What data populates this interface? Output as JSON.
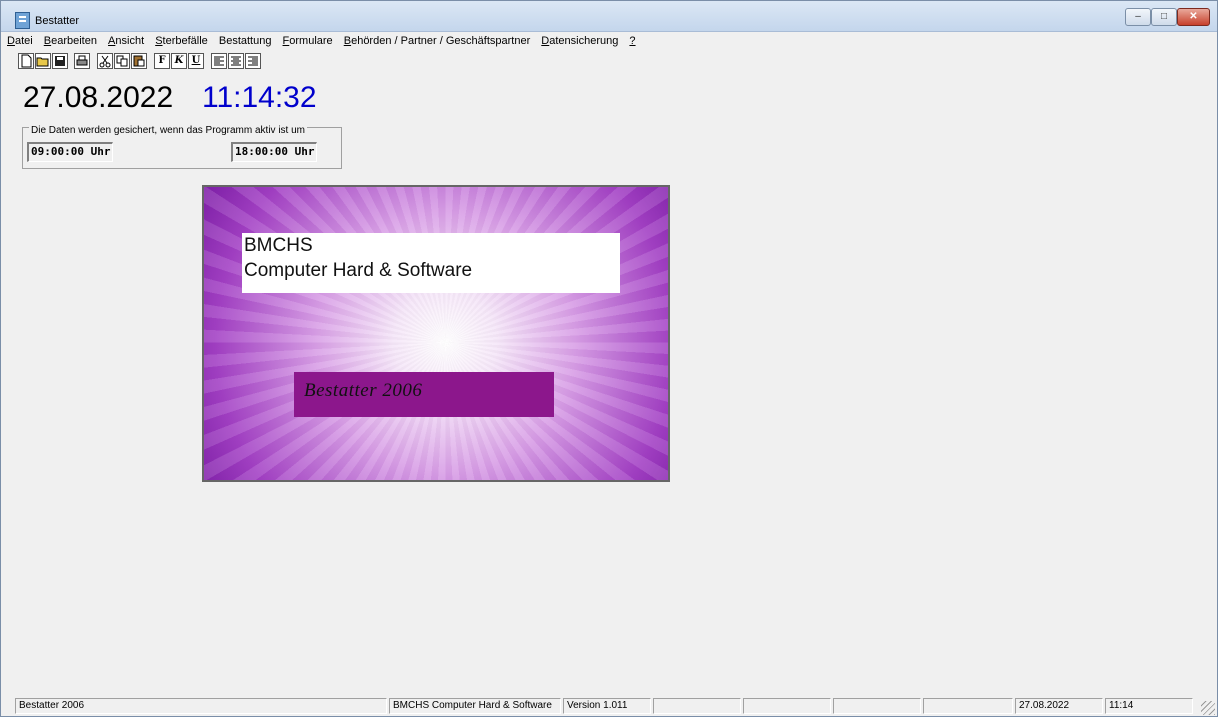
{
  "window": {
    "title": "Bestatter"
  },
  "controls": {
    "minimize": "–",
    "maximize": "□",
    "close": "✕"
  },
  "menu": [
    {
      "mnemonic": "D",
      "rest": "atei"
    },
    {
      "mnemonic": "B",
      "rest": "earbeiten"
    },
    {
      "mnemonic": "A",
      "rest": "nsicht"
    },
    {
      "mnemonic": "S",
      "rest": "terbefälle"
    },
    {
      "mnemonic": "",
      "rest": "Bestattung"
    },
    {
      "mnemonic": "F",
      "rest": "ormulare"
    },
    {
      "mnemonic": "B",
      "rest": "ehörden / Partner / Geschäftspartner"
    },
    {
      "mnemonic": "D",
      "rest": "atensicherung"
    },
    {
      "mnemonic": "?",
      "rest": ""
    }
  ],
  "toolbar": {
    "new": "new-document-icon",
    "open": "open-folder-icon",
    "save": "save-icon",
    "print": "print-icon",
    "cut": "cut-icon",
    "copy": "copy-icon",
    "paste": "paste-icon",
    "bold": "F",
    "italic": "K",
    "underline": "U",
    "align_left": "align-left-icon",
    "align_center": "align-center-icon",
    "align_right": "align-right-icon"
  },
  "clock": {
    "date": "27.08.2022",
    "time": "11:14:32"
  },
  "backup": {
    "label": "Die Daten werden gesichert, wenn das Programm aktiv ist um",
    "time1": "09:00:00 Uhr",
    "time2": "18:00:00 Uhr"
  },
  "splash": {
    "company_line1": "BMCHS",
    "company_line2": "Computer Hard & Software",
    "product": "Bestatter 2006"
  },
  "status": {
    "app": "Bestatter 2006",
    "company": "BMCHS Computer Hard & Software",
    "version": "Version 1.011",
    "date": "27.08.2022",
    "time": "11:14"
  }
}
